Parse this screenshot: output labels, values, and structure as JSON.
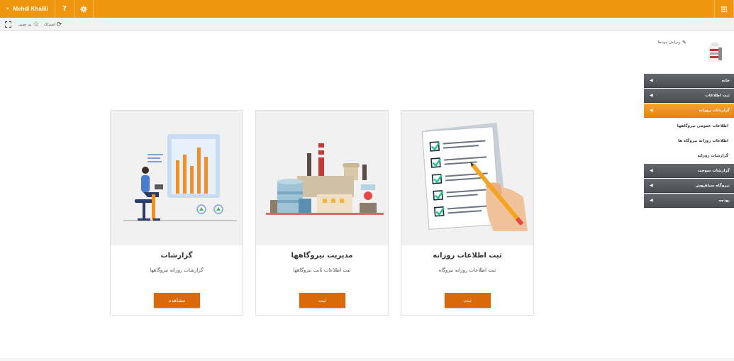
{
  "topbar": {
    "user_name": "Mehdi Khalili",
    "help_label": "?",
    "settings_icon": "gear-icon",
    "apps_icon": "app-launcher-icon",
    "color": "#f0960e"
  },
  "toolbar": {
    "follow_label": "پی جویی",
    "share_label": "اشتراک"
  },
  "edit_links_label": "ویرایش پیوندها",
  "nav": {
    "items": [
      {
        "label": "خانه"
      },
      {
        "label": "ثبت اطلاعات"
      },
      {
        "label": "گزارشات روزانه",
        "active": true
      },
      {
        "label": "گزارشات سوخت"
      },
      {
        "label": "نیروگاه سیاهپوش"
      },
      {
        "label": "بودجه"
      }
    ],
    "subitems": [
      {
        "label": "اطلاعات عمومی نیروگاهها"
      },
      {
        "label": "اطلاعات روزانه نیروگاه ها"
      },
      {
        "label": "گزارشات روزانه"
      }
    ]
  },
  "cards": [
    {
      "title": "ثبت اطلاعات روزانه",
      "desc": "ثبت اطلاعات روزانه نیروگاه",
      "button": "ثبت",
      "image": "checklist-illustration"
    },
    {
      "title": "مدیریت نیروگاهها",
      "desc": "ثبت اطلاعات ثابت نیروگاهها",
      "button": "ثبت",
      "image": "factory-illustration"
    },
    {
      "title": "گزارشات",
      "desc": "گزارشات روزانه نیروگاهها",
      "button": "مشاهده",
      "image": "reports-illustration"
    }
  ],
  "colors": {
    "accent": "#f0960e",
    "button": "#d9690a",
    "nav_dark": "#55595f"
  }
}
